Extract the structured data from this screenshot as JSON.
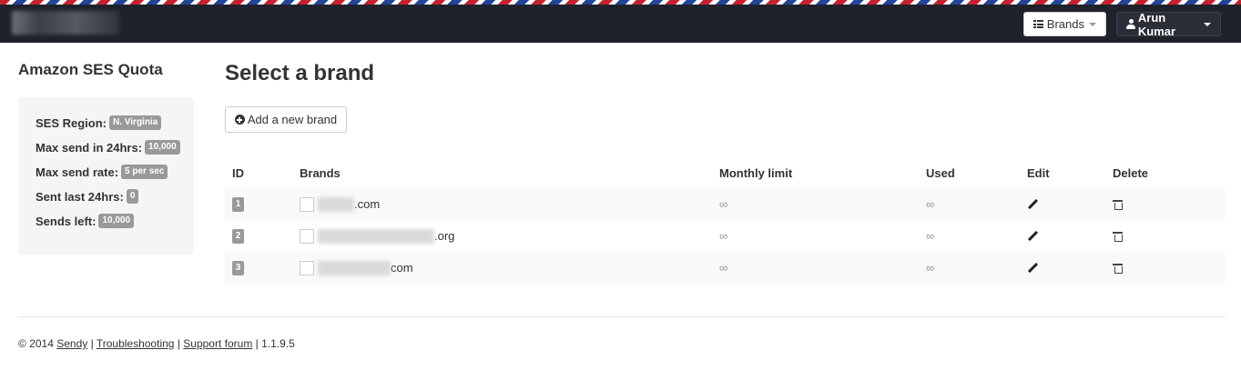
{
  "navbar": {
    "brands_label": "Brands",
    "user_label": "Arun Kumar"
  },
  "sidebar": {
    "title": "Amazon SES Quota",
    "rows": [
      {
        "label": "SES Region:",
        "value": "N. Virginia"
      },
      {
        "label": "Max send in 24hrs:",
        "value": "10,000"
      },
      {
        "label": "Max send rate:",
        "value": "5 per sec"
      },
      {
        "label": "Sent last 24hrs:",
        "value": "0"
      },
      {
        "label": "Sends left:",
        "value": "10,000"
      }
    ]
  },
  "main": {
    "title": "Select a brand",
    "add_button_label": "Add a new brand"
  },
  "table": {
    "headers": [
      "ID",
      "Brands",
      "Monthly limit",
      "Used",
      "Edit",
      "Delete"
    ],
    "rows": [
      {
        "id": "1",
        "brand_suffix": ".com",
        "monthly_limit": "∞",
        "used": "∞"
      },
      {
        "id": "2",
        "brand_suffix": ".org",
        "monthly_limit": "∞",
        "used": "∞"
      },
      {
        "id": "3",
        "brand_suffix": "com",
        "monthly_limit": "∞",
        "used": "∞"
      }
    ]
  },
  "footer": {
    "copyright": "© 2014",
    "link_sendy": "Sendy",
    "sep1": "|",
    "link_troubleshooting": "Troubleshooting",
    "sep2": "|",
    "link_support": "Support forum",
    "version": "| 1.1.9.5"
  }
}
